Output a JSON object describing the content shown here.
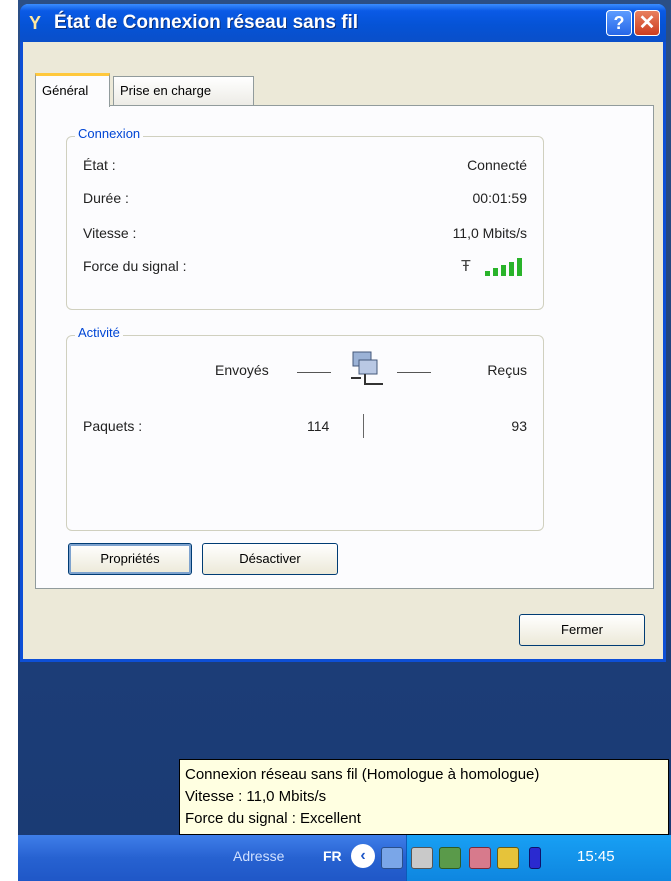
{
  "window": {
    "title": "État de Connexion réseau sans fil",
    "help_label": "?",
    "close_label": "✕"
  },
  "tabs": [
    {
      "label": "Général",
      "active": true
    },
    {
      "label": "Prise en charge",
      "active": false
    }
  ],
  "connection": {
    "legend": "Connexion",
    "rows": [
      {
        "label": "État :",
        "value": "Connecté"
      },
      {
        "label": "Durée :",
        "value": "00:01:59"
      },
      {
        "label": "Vitesse :",
        "value": "11,0 Mbits/s"
      },
      {
        "label": "Force du signal :",
        "value": ""
      }
    ],
    "signal_bars": 5,
    "signal_color": "#29b32a"
  },
  "activity": {
    "legend": "Activité",
    "sent_header": "Envoyés",
    "received_header": "Reçus",
    "packets_label": "Paquets :",
    "packets_sent": "114",
    "packets_received": "93"
  },
  "buttons": {
    "properties": "Propriétés",
    "disable": "Désactiver",
    "close": "Fermer"
  },
  "tooltip": {
    "line1": "Connexion réseau sans fil (Homologue à homologue)",
    "line2": "Vitesse : 11,0 Mbits/s",
    "line3": "Force du signal : Excellent"
  },
  "taskbar": {
    "address_label": "Adresse",
    "language": "FR",
    "clock": "15:45",
    "tray_icons": [
      "network-icon",
      "printer-icon",
      "user-icon",
      "network-bridge-icon",
      "security-alert-icon",
      "battery-icon"
    ]
  }
}
